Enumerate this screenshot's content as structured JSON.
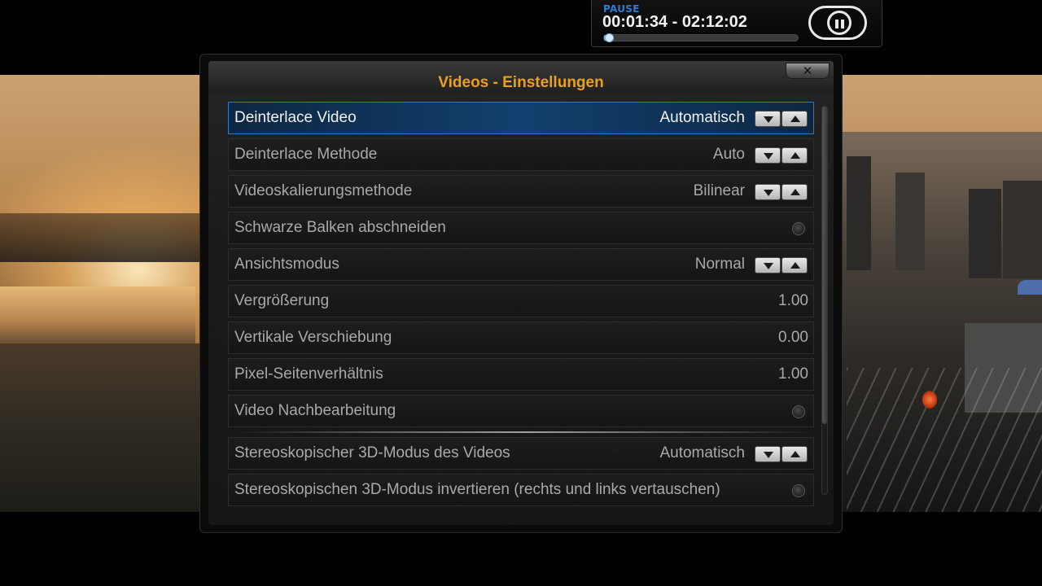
{
  "osd": {
    "state": "PAUSE",
    "time": "00:01:34 - 02:12:02",
    "progress_fraction": 0.012
  },
  "dialog": {
    "title": "Videos - Einstellungen",
    "close_label": "✕"
  },
  "settings": [
    {
      "label": "Deinterlace Video",
      "value": "Automatisch",
      "control": "spinner",
      "focused": true
    },
    {
      "label": "Deinterlace Methode",
      "value": "Auto",
      "control": "spinner"
    },
    {
      "label": "Videoskalierungsmethode",
      "value": "Bilinear",
      "control": "spinner"
    },
    {
      "label": "Schwarze Balken abschneiden",
      "value": "",
      "control": "radio"
    },
    {
      "label": "Ansichtsmodus",
      "value": "Normal",
      "control": "spinner"
    },
    {
      "label": "Vergrößerung",
      "value": "1.00",
      "control": "number"
    },
    {
      "label": "Vertikale Verschiebung",
      "value": "0.00",
      "control": "number"
    },
    {
      "label": "Pixel-Seitenverhältnis",
      "value": "1.00",
      "control": "number"
    },
    {
      "label": "Video Nachbearbeitung",
      "value": "",
      "control": "radio"
    },
    {
      "label": "Stereoskopischer 3D-Modus des Videos",
      "value": "Automatisch",
      "control": "spinner"
    },
    {
      "label": "Stereoskopischen 3D-Modus invertieren (rechts und links vertauschen)",
      "value": "",
      "control": "radio"
    }
  ],
  "colors": {
    "title": "#e8a020",
    "focus": "#2e7bc4",
    "osd_state": "#2a7fd4"
  }
}
